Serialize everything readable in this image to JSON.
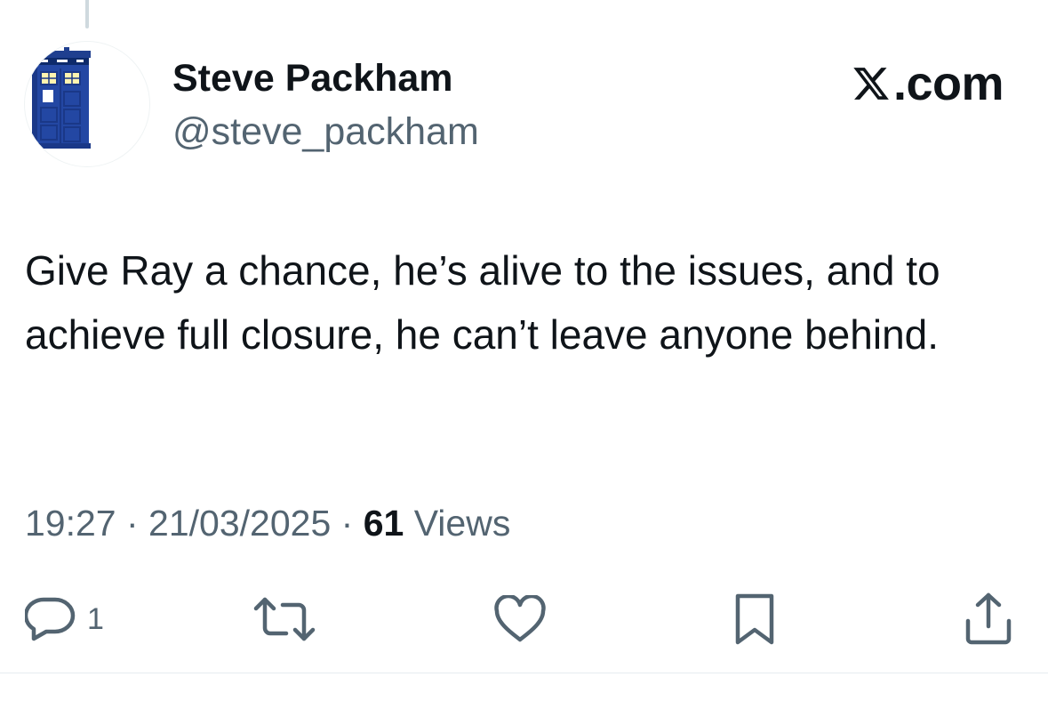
{
  "author": {
    "display_name": "Steve Packham",
    "handle": "@steve_packham",
    "avatar": "police-box-avatar"
  },
  "brand": {
    "icon": "x-logo-icon",
    "label": ".com"
  },
  "tweet": {
    "text": "Give Ray a chance, he’s alive to the issues, and to achieve full closure, he can’t leave anyone behind.",
    "time": "19:27",
    "date": "21/03/2025",
    "separator": " · ",
    "views_count": "61",
    "views_label": "Views"
  },
  "actions": {
    "reply_icon": "reply-icon",
    "reply_count": "1",
    "retweet_icon": "retweet-icon",
    "like_icon": "heart-icon",
    "bookmark_icon": "bookmark-icon",
    "share_icon": "share-icon"
  },
  "colors": {
    "text_primary": "#0f1419",
    "text_secondary": "#536471",
    "icon_gray": "#536471",
    "avatar_blue": "#1f3f8f"
  }
}
